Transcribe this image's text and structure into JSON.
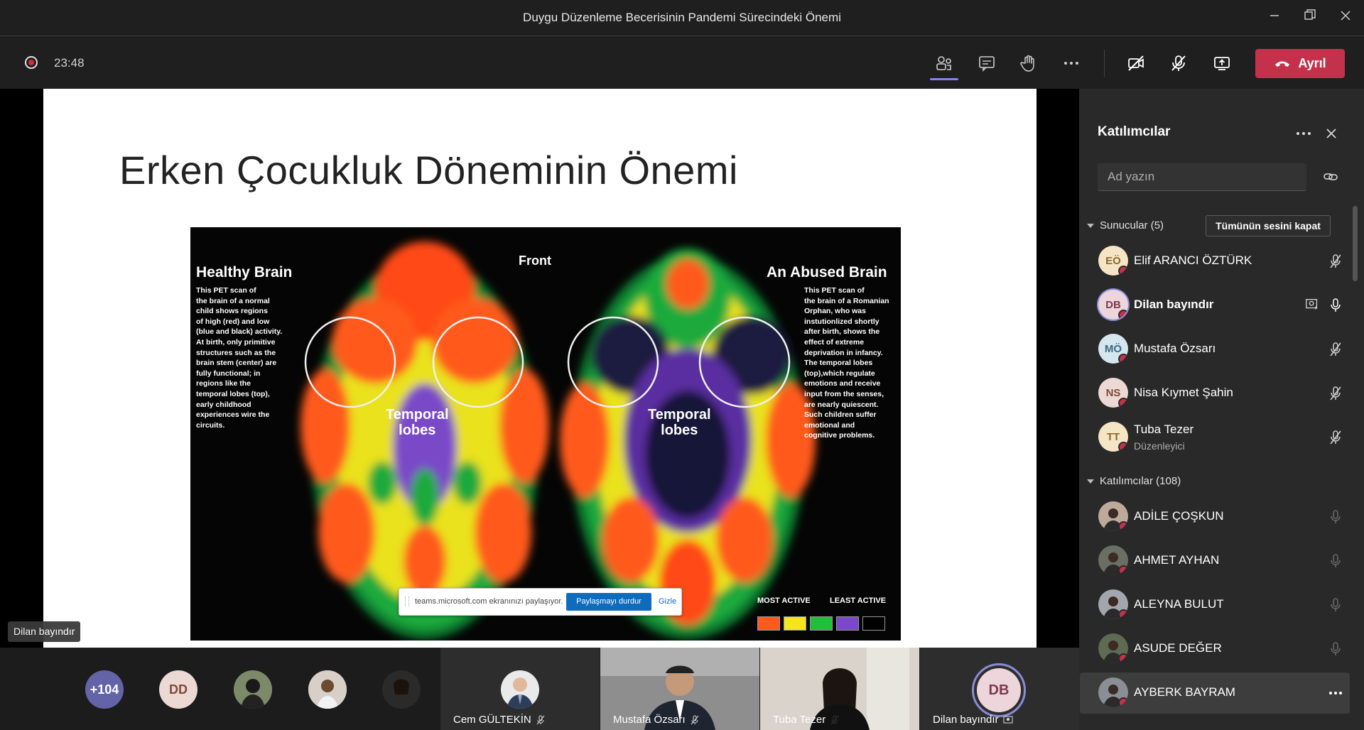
{
  "window": {
    "title": "Duygu Düzenleme Becerisinin Pandemi Sürecindeki Önemi"
  },
  "toolbar": {
    "timer": "23:48",
    "leave_label": "Ayrıl",
    "icons": [
      "participants-icon",
      "chat-icon",
      "raise-hand-icon",
      "more-icon",
      "camera-off-icon",
      "mic-off-icon",
      "share-icon",
      "phone-icon"
    ]
  },
  "slide": {
    "title": "Erken Çocukluk Döneminin Önemi",
    "scan": {
      "left_title": "Healthy Brain",
      "front_label": "Front",
      "right_title": "An Abused Brain",
      "left_text": "This PET scan of\nthe brain of a normal\nchild shows regions\nof high (red) and low\n(blue and black) activity.\nAt birth, only primitive\nstructures such as the\nbrain stem (center) are\nfully functional; in\nregions like the\ntemporal lobes (top),\nearly childhood\nexperiences wire the\ncircuits.",
      "right_text": "This PET scan of\nthe brain of a Romanian\nOrphan, who was\ninstutionlized shortly\nafter birth, shows the\neffect of extreme\ndeprivation in infancy.\nThe temporal lobes\n(top),which regulate\nemotions and receive\ninput from the senses,\nare nearly quiescent.\nSuch children suffer\nemotional and\ncognitive problems.",
      "temporal_label_1": "Temporal",
      "temporal_label_2": "lobes",
      "legend_most": "MOST ACTIVE",
      "legend_least": "LEAST ACTIVE",
      "legend_colors": [
        "#ff5a1e",
        "#f5e51e",
        "#1fbf3a",
        "#7a48c8",
        "#000000"
      ]
    }
  },
  "share_banner": {
    "message": "teams.microsoft.com ekranınızı paylaşıyor.",
    "stop_label": "Paylaşmayı durdur",
    "hide_label": "Gizle"
  },
  "presenter_label": "Dilan bayındır",
  "gallery": {
    "overflow": "+104",
    "avatars": [
      {
        "initials": "DD"
      }
    ],
    "tiles": [
      {
        "name": "Cem GÜLTEKİN"
      },
      {
        "name": "Mustafa Özsarı"
      },
      {
        "name": "Tuba Tezer"
      },
      {
        "name": "Dilan bayındır",
        "initials": "DB"
      }
    ]
  },
  "panel": {
    "title": "Katılımcılar",
    "search_placeholder": "Ad yazın",
    "presenters_header": "Sunucular (5)",
    "mute_all_label": "Tümünün sesini kapat",
    "presenters": [
      {
        "initials": "EÖ",
        "name": "Elif ARANCI ÖZTÜRK",
        "bg": "#f6e5c5",
        "fg": "#8a6a2f"
      },
      {
        "initials": "DB",
        "name": "Dilan bayındır",
        "bg": "#ecd6dc",
        "fg": "#7e3a4d"
      },
      {
        "initials": "MÖ",
        "name": "Mustafa Özsarı",
        "bg": "#d6e6ef",
        "fg": "#3a6a86"
      },
      {
        "initials": "NS",
        "name": "Nisa Kıymet Şahin",
        "bg": "#ecd9d3",
        "fg": "#7e4b3a"
      },
      {
        "initials": "TT",
        "name": "Tuba Tezer",
        "sub": "Düzenleyici",
        "bg": "#f6e5c5",
        "fg": "#8a6a2f"
      }
    ],
    "attendees_header": "Katılımcılar (108)",
    "attendees": [
      {
        "name": "ADİLE ÇOŞKUN"
      },
      {
        "name": "AHMET AYHAN"
      },
      {
        "name": "ALEYNA BULUT"
      },
      {
        "name": "ASUDE DEĞER"
      },
      {
        "name": "AYBERK BAYRAM"
      }
    ]
  }
}
